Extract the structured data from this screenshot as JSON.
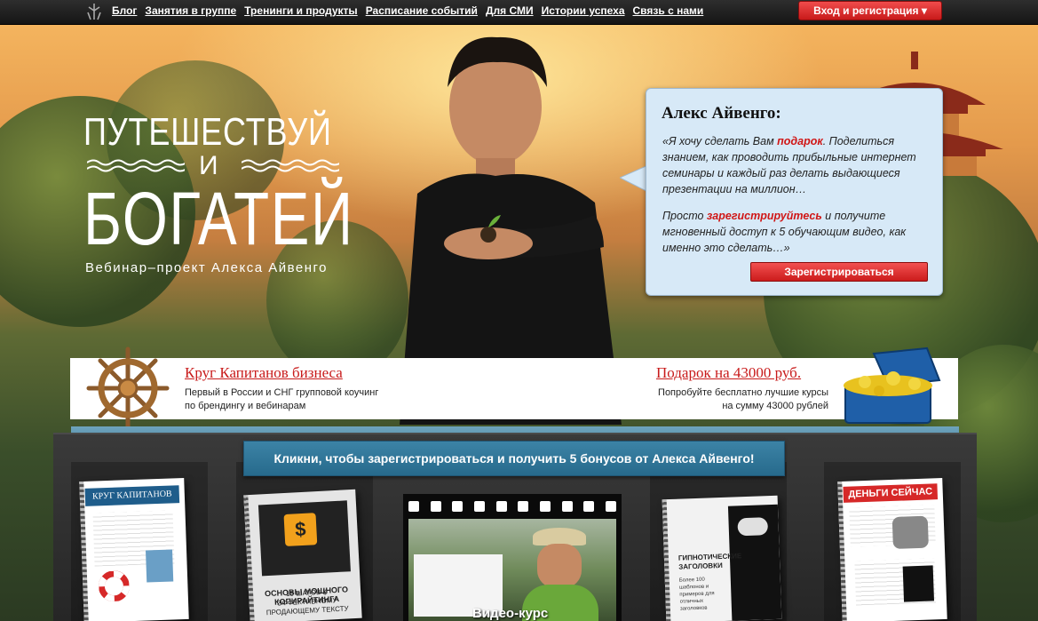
{
  "nav": {
    "items": [
      {
        "label": "Блог"
      },
      {
        "label": "Занятия в группе"
      },
      {
        "label": "Тренинги и продукты"
      },
      {
        "label": "Расписание событий"
      },
      {
        "label": "Для СМИ"
      },
      {
        "label": "Истории успеха"
      },
      {
        "label": "Связь с нами"
      }
    ],
    "login_label": "Вход и регистрация ▾"
  },
  "hero": {
    "title_top": "ПУТЕШЕСТВУЙ",
    "title_mid": "И",
    "title_big": "БОГАТЕЙ",
    "subtitle": "Вебинар–проект Алекса Айвенго"
  },
  "bubble": {
    "name": "Алекс Айвенго:",
    "quote1_a": "«Я хочу сделать Вам ",
    "quote1_hl": "подарок",
    "quote1_b": ". Поделиться знанием, как проводить прибыльные интернет семинары и каждый раз делать выдающиеся презентации на миллион…",
    "quote2_a": "Просто ",
    "quote2_hl": "зарегистрируйтесь",
    "quote2_b": " и получите мгновенный доступ к 5 обучающим видео, как именно это сделать…»",
    "button_label": "Зарегистрироваться"
  },
  "promo": {
    "left_title": "Круг Капитанов бизнеса",
    "left_text": "Первый в России и СНГ групповой коучинг по брендингу и вебинарам",
    "right_title": "Подарок на 43000 руб.",
    "right_text": "Попробуйте бесплатно лучшие курсы на сумму 43000 рублей"
  },
  "bonus": {
    "ribbon_label": "Кликни, чтобы зарегистрироваться и получить 5 бонусов от Алекса Айвенго!",
    "book1_title": "КРУГ КАПИТАНОВ",
    "book2_title": "ОСНОВЫ МОЩНОГО КОПИРАЙТИНГА",
    "book2_text": "15 ШАГОВ К ЭФФЕКТИВНОМУ ПРОДАЮЩЕМУ ТЕКСТУ",
    "book4_title": "ГИПНОТИЧЕСКИЕ ЗАГОЛОВКИ",
    "book4_text": "Более 100 шаблонов и примеров для отличных заголовков",
    "book5_title": "ДЕНЬГИ СЕЙЧАС",
    "video_label": "Видео-курс"
  },
  "colors": {
    "accent_red": "#c81a1a",
    "ribbon_blue": "#2f779a",
    "bubble_bg": "#d7e9f7"
  }
}
